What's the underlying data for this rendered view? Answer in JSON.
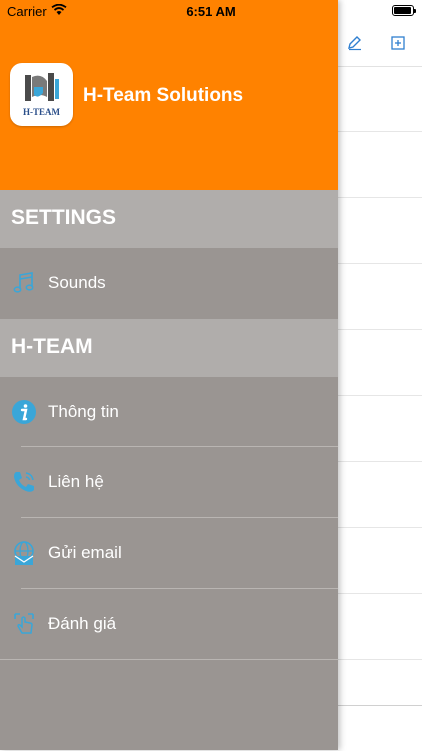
{
  "status_bar": {
    "carrier": "Carrier",
    "time": "6:51 AM"
  },
  "drawer": {
    "app_name": "H-Team Solutions",
    "logo_text": "H-TEAM",
    "sections": [
      {
        "title": "SETTINGS",
        "items": [
          {
            "label": "Sounds",
            "icon": "music-note-icon"
          }
        ]
      },
      {
        "title": "H-TEAM",
        "items": [
          {
            "label": "Thông tin",
            "icon": "info-icon"
          },
          {
            "label": "Liên hệ",
            "icon": "phone-icon"
          },
          {
            "label": "Gửi email",
            "icon": "globe-email-icon"
          },
          {
            "label": "Đánh giá",
            "icon": "rate-hand-icon"
          }
        ]
      }
    ]
  },
  "colors": {
    "header_bg": "#ff8200",
    "drawer_bg": "#9a9592",
    "section_bg": "#b0adab",
    "icon_accent": "#3aa6d8"
  }
}
